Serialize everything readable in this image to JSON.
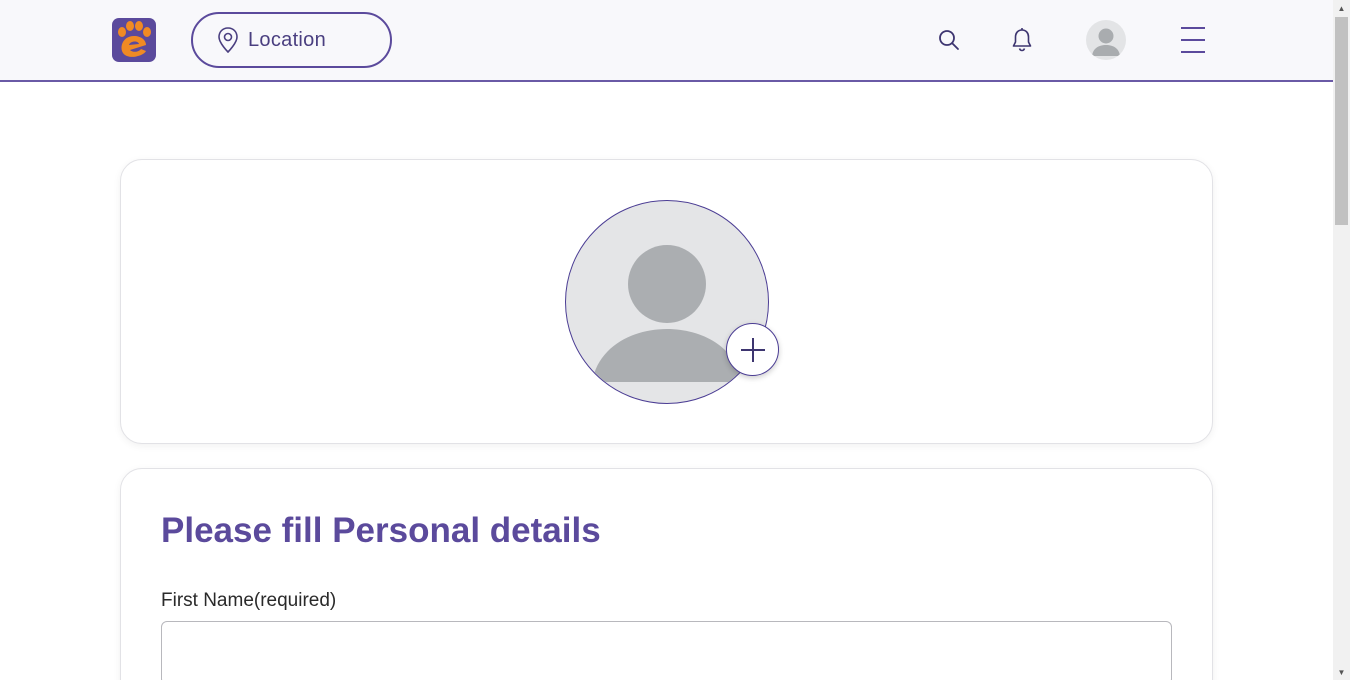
{
  "header": {
    "location_label": "Location"
  },
  "colors": {
    "brand_purple": "#5b4a9c",
    "logo_orange": "#f08a24"
  },
  "icons": {
    "logo": "paw-e-logo-icon",
    "location": "map-pin-icon",
    "search": "search-icon",
    "notifications": "bell-icon",
    "profile": "user-avatar-icon",
    "menu": "hamburger-menu-icon",
    "add_photo": "plus-icon"
  },
  "details_form": {
    "title": "Please fill Personal details",
    "first_name_label": "First Name(required)",
    "first_name_value": ""
  }
}
